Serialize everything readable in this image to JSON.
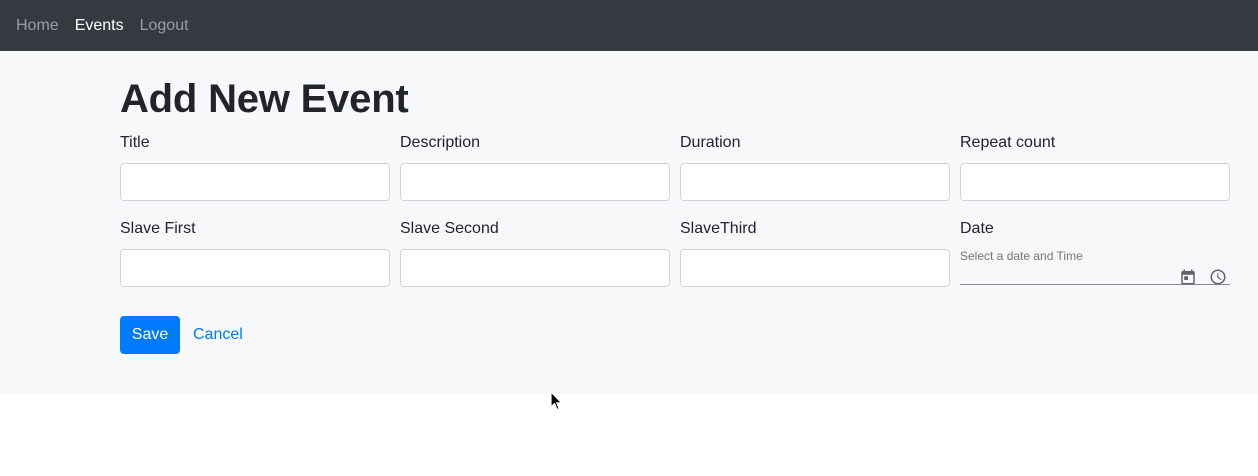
{
  "nav": {
    "items": [
      {
        "label": "Home",
        "active": false
      },
      {
        "label": "Events",
        "active": true
      },
      {
        "label": "Logout",
        "active": false
      }
    ]
  },
  "page": {
    "title": "Add New Event"
  },
  "form": {
    "title": {
      "label": "Title",
      "value": ""
    },
    "description": {
      "label": "Description",
      "value": ""
    },
    "duration": {
      "label": "Duration",
      "value": ""
    },
    "repeat_count": {
      "label": "Repeat count",
      "value": ""
    },
    "slave_first": {
      "label": "Slave First",
      "value": ""
    },
    "slave_second": {
      "label": "Slave Second",
      "value": ""
    },
    "slave_third": {
      "label": "SlaveThird",
      "value": ""
    },
    "date": {
      "label": "Date",
      "helper": "Select a date and Time",
      "icons": [
        "calendar-icon",
        "clock-icon"
      ]
    }
  },
  "actions": {
    "save_label": "Save",
    "cancel_label": "Cancel"
  },
  "colors": {
    "navbar_bg": "#343a40",
    "content_bg": "#f7f8f9",
    "primary": "#007bff"
  }
}
